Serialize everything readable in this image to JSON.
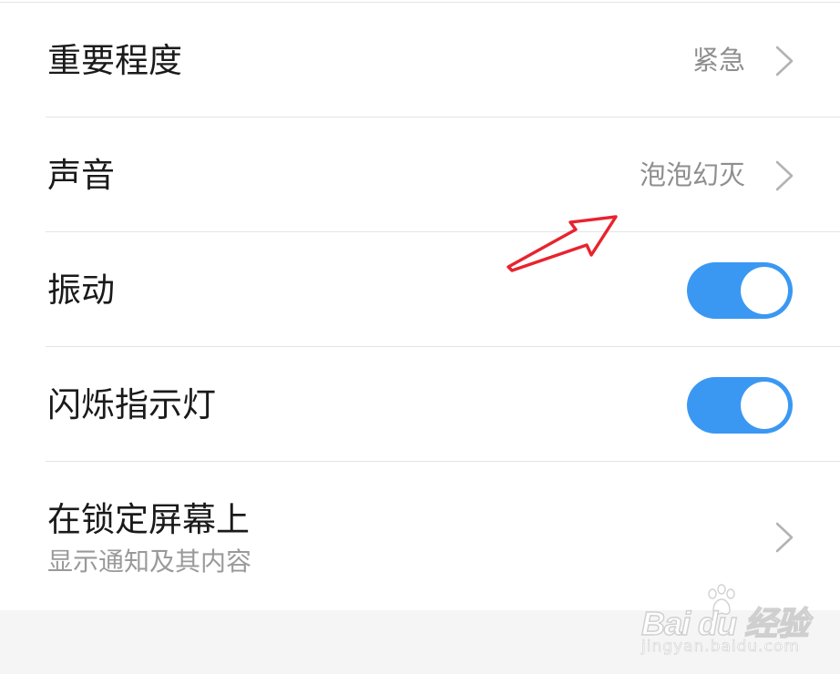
{
  "settings": {
    "importance": {
      "title": "重要程度",
      "value": "紧急"
    },
    "sound": {
      "title": "声音",
      "value": "泡泡幻灭"
    },
    "vibration": {
      "title": "振动",
      "enabled": true
    },
    "led": {
      "title": "闪烁指示灯",
      "enabled": true
    },
    "lock_screen": {
      "title": "在锁定屏幕上",
      "subtitle": "显示通知及其内容"
    }
  },
  "colors": {
    "toggle_on": "#3a98f3",
    "annotation_arrow": "#e8232e"
  },
  "icons": {
    "row_chevron": "chevron-right-icon",
    "annotation": "red-arrow-icon",
    "watermark_paw": "baidu-paw-icon"
  },
  "watermark": {
    "brand": "Bai du 经验",
    "url": "jingyan.baidu.com"
  }
}
